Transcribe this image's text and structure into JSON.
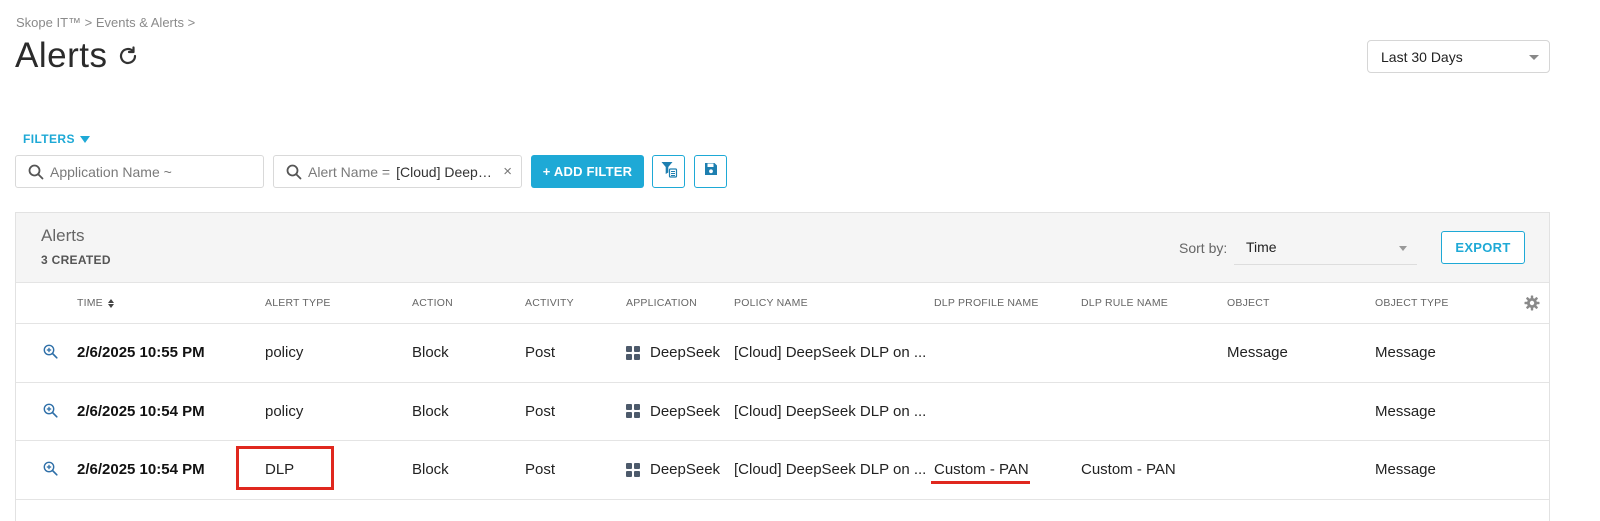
{
  "breadcrumb": "Skope IT™ > Events & Alerts >",
  "page": {
    "title": "Alerts"
  },
  "date_range": {
    "value": "Last 30 Days"
  },
  "filters": {
    "toggle_label": "FILTERS",
    "app_placeholder": "Application Name ~",
    "alert_label": "Alert Name =",
    "alert_value": "[Cloud] DeepSe...",
    "add_filter_label": "+ ADD FILTER"
  },
  "panel": {
    "title": "Alerts",
    "count": "3 CREATED",
    "sort_label": "Sort by:",
    "sort_value": "Time",
    "export_label": "EXPORT"
  },
  "columns": [
    "TIME",
    "ALERT TYPE",
    "ACTION",
    "ACTIVITY",
    "APPLICATION",
    "POLICY NAME",
    "DLP PROFILE NAME",
    "DLP RULE NAME",
    "OBJECT",
    "OBJECT TYPE"
  ],
  "rows": [
    {
      "time": "2/6/2025 10:55 PM",
      "alert_type": "policy",
      "action": "Block",
      "activity": "Post",
      "application": "DeepSeek",
      "policy_name": "[Cloud] DeepSeek DLP on ...",
      "dlp_profile": "",
      "dlp_rule": "",
      "object": "Message",
      "object_type": "Message"
    },
    {
      "time": "2/6/2025 10:54 PM",
      "alert_type": "policy",
      "action": "Block",
      "activity": "Post",
      "application": "DeepSeek",
      "policy_name": "[Cloud] DeepSeek DLP on ...",
      "dlp_profile": "",
      "dlp_rule": "",
      "object": "",
      "object_type": "Message"
    },
    {
      "time": "2/6/2025 10:54 PM",
      "alert_type": "DLP",
      "action": "Block",
      "activity": "Post",
      "application": "DeepSeek",
      "policy_name": "[Cloud] DeepSeek DLP on ...",
      "dlp_profile": "Custom - PAN",
      "dlp_rule": "Custom - PAN",
      "object": "",
      "object_type": "Message"
    }
  ],
  "colors": {
    "accent": "#1ea9d6",
    "highlight": "#e0281e",
    "app_icon": "#4d5a6b"
  },
  "icons": [
    "refresh-icon",
    "search-icon",
    "clear-icon",
    "filter-list-icon",
    "save-icon",
    "settings-gear-icon",
    "zoom-in-icon",
    "app-grid-icon"
  ]
}
